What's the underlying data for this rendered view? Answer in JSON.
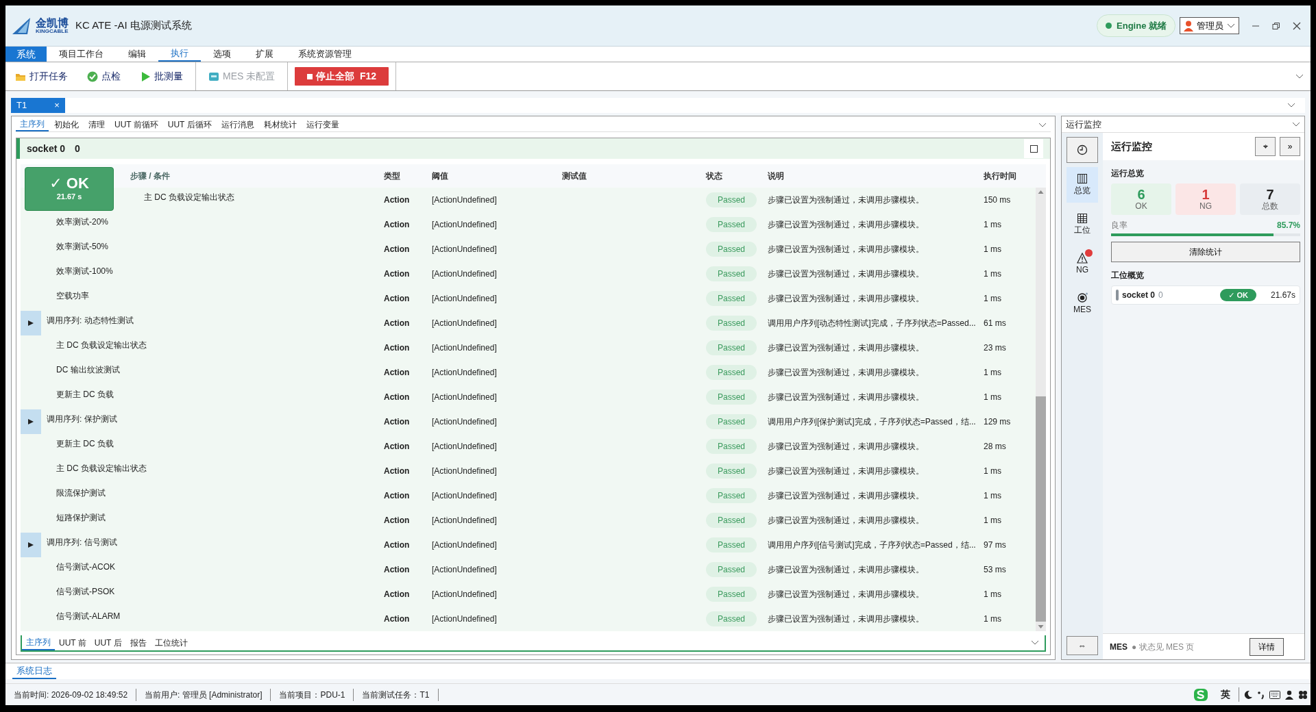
{
  "window": {
    "title": "KC ATE -AI 电源测试系统",
    "brand": "金凯博",
    "brand_sub": "KINGCABLE",
    "engine": {
      "label": "Engine 就绪",
      "color": "#2e9b5c"
    },
    "user": "管理员"
  },
  "menu": [
    {
      "label": "系统",
      "kind": "app",
      "selected": false
    },
    {
      "label": "项目工作台",
      "kind": "item",
      "selected": false
    },
    {
      "label": "编辑",
      "kind": "item",
      "selected": false
    },
    {
      "label": "执行",
      "kind": "item",
      "selected": true
    },
    {
      "label": "选项",
      "kind": "item",
      "selected": false
    },
    {
      "label": "扩展",
      "kind": "item",
      "selected": false
    },
    {
      "label": "系统资源管理",
      "kind": "item",
      "selected": false
    }
  ],
  "toolbar": [
    {
      "label": "打开任务",
      "kind": "folder",
      "disabled": false
    },
    {
      "label": "点检",
      "kind": "check",
      "disabled": false
    },
    {
      "label": "批测量",
      "kind": "play",
      "disabled": false
    },
    {
      "label": "MES 未配置",
      "kind": "mes",
      "disabled": true
    },
    {
      "label": "停止全部  F12",
      "kind": "stop",
      "disabled": false
    }
  ],
  "doc_tabs": [
    {
      "label": "T1",
      "close": "×",
      "selected": true
    }
  ],
  "sub_tabs": [
    {
      "label": "主序列",
      "selected": true
    },
    {
      "label": "初始化",
      "selected": false
    },
    {
      "label": "清理",
      "selected": false
    },
    {
      "label": "UUT 前循环",
      "selected": false
    },
    {
      "label": "UUT 后循环",
      "selected": false
    },
    {
      "label": "运行消息",
      "selected": false
    },
    {
      "label": "耗材统计",
      "selected": false
    },
    {
      "label": "运行变量",
      "selected": false
    }
  ],
  "socket": {
    "title": "socket 0",
    "count": "0",
    "result": {
      "label": "✓ OK",
      "time": "21.67 s"
    }
  },
  "table": {
    "columns": [
      "步骤 / 条件",
      "类型",
      "阈值",
      "测试值",
      "状态",
      "说明",
      "执行时间"
    ],
    "rows": [
      {
        "kind": "step",
        "name": "主 DC 负载设定输出状态",
        "type": "Action",
        "threshold": "[ActionUndefined]",
        "status": "Passed",
        "description": "步骤已设置为强制通过，未调用步骤模块。",
        "time": "150 ms"
      },
      {
        "kind": "step",
        "name": "效率测试-20%",
        "type": "Action",
        "threshold": "[ActionUndefined]",
        "status": "Passed",
        "description": "步骤已设置为强制通过，未调用步骤模块。",
        "time": "1 ms"
      },
      {
        "kind": "step",
        "name": "效率测试-50%",
        "type": "Action",
        "threshold": "[ActionUndefined]",
        "status": "Passed",
        "description": "步骤已设置为强制通过，未调用步骤模块。",
        "time": "1 ms"
      },
      {
        "kind": "step",
        "name": "效率测试-100%",
        "type": "Action",
        "threshold": "[ActionUndefined]",
        "status": "Passed",
        "description": "步骤已设置为强制通过，未调用步骤模块。",
        "time": "1 ms"
      },
      {
        "kind": "step",
        "name": "空载功率",
        "type": "Action",
        "threshold": "[ActionUndefined]",
        "status": "Passed",
        "description": "步骤已设置为强制通过，未调用步骤模块。",
        "time": "1 ms"
      },
      {
        "kind": "call",
        "name": "调用序列: 动态特性测试",
        "type": "Action",
        "threshold": "[ActionUndefined]",
        "status": "Passed",
        "description": "调用用户序列[动态特性测试]完成，子序列状态=Passed...",
        "time": "61 ms"
      },
      {
        "kind": "step",
        "name": "主 DC 负载设定输出状态",
        "type": "Action",
        "threshold": "[ActionUndefined]",
        "status": "Passed",
        "description": "步骤已设置为强制通过，未调用步骤模块。",
        "time": "23 ms"
      },
      {
        "kind": "step",
        "name": "DC 输出纹波测试",
        "type": "Action",
        "threshold": "[ActionUndefined]",
        "status": "Passed",
        "description": "步骤已设置为强制通过，未调用步骤模块。",
        "time": "1 ms"
      },
      {
        "kind": "step",
        "name": "更新主 DC 负载",
        "type": "Action",
        "threshold": "[ActionUndefined]",
        "status": "Passed",
        "description": "步骤已设置为强制通过，未调用步骤模块。",
        "time": "1 ms"
      },
      {
        "kind": "call",
        "name": "调用序列: 保护测试",
        "type": "Action",
        "threshold": "[ActionUndefined]",
        "status": "Passed",
        "description": "调用用户序列[保护测试]完成，子序列状态=Passed，结...",
        "time": "129 ms"
      },
      {
        "kind": "step",
        "name": "更新主 DC 负载",
        "type": "Action",
        "threshold": "[ActionUndefined]",
        "status": "Passed",
        "description": "步骤已设置为强制通过，未调用步骤模块。",
        "time": "28 ms"
      },
      {
        "kind": "step",
        "name": "主 DC 负载设定输出状态",
        "type": "Action",
        "threshold": "[ActionUndefined]",
        "status": "Passed",
        "description": "步骤已设置为强制通过，未调用步骤模块。",
        "time": "1 ms"
      },
      {
        "kind": "step",
        "name": "限流保护测试",
        "type": "Action",
        "threshold": "[ActionUndefined]",
        "status": "Passed",
        "description": "步骤已设置为强制通过，未调用步骤模块。",
        "time": "1 ms"
      },
      {
        "kind": "step",
        "name": "短路保护测试",
        "type": "Action",
        "threshold": "[ActionUndefined]",
        "status": "Passed",
        "description": "步骤已设置为强制通过，未调用步骤模块。",
        "time": "1 ms"
      },
      {
        "kind": "call",
        "name": "调用序列: 信号测试",
        "type": "Action",
        "threshold": "[ActionUndefined]",
        "status": "Passed",
        "description": "调用用户序列[信号测试]完成，子序列状态=Passed，结...",
        "time": "97 ms"
      },
      {
        "kind": "step",
        "name": "信号测试-ACOK",
        "type": "Action",
        "threshold": "[ActionUndefined]",
        "status": "Passed",
        "description": "步骤已设置为强制通过，未调用步骤模块。",
        "time": "53 ms"
      },
      {
        "kind": "step",
        "name": "信号测试-PSOK",
        "type": "Action",
        "threshold": "[ActionUndefined]",
        "status": "Passed",
        "description": "步骤已设置为强制通过，未调用步骤模块。",
        "time": "1 ms"
      },
      {
        "kind": "step",
        "name": "信号测试-ALARM",
        "type": "Action",
        "threshold": "[ActionUndefined]",
        "status": "Passed",
        "description": "步骤已设置为强制通过，未调用步骤模块。",
        "time": "1 ms"
      }
    ]
  },
  "bottom_tabs": [
    {
      "label": "主序列",
      "selected": true
    },
    {
      "label": "UUT 前",
      "selected": false
    },
    {
      "label": "UUT 后",
      "selected": false
    },
    {
      "label": "报告",
      "selected": false
    },
    {
      "label": "工位统计",
      "selected": false
    }
  ],
  "monitor": {
    "panel_title": "运行监控",
    "title": "运行监控",
    "locate_button": "⌖",
    "collapse_button": "»",
    "swap_button": "⇔",
    "nav": [
      {
        "label": "总览",
        "kind": "overview",
        "selected": true,
        "alert": false
      },
      {
        "label": "工位",
        "kind": "stations",
        "selected": false,
        "alert": false
      },
      {
        "label": "NG",
        "kind": "ng",
        "selected": false,
        "alert": true
      },
      {
        "label": "MES",
        "kind": "mes",
        "selected": false,
        "alert": false
      }
    ],
    "summary_title": "运行总览",
    "stats": [
      {
        "value": "6",
        "label": "OK",
        "kind": "ok"
      },
      {
        "value": "1",
        "label": "NG",
        "kind": "ng"
      },
      {
        "value": "7",
        "label": "总数",
        "kind": "total"
      }
    ],
    "yield": {
      "label": "良率",
      "reading": "85.7%",
      "level": 0.857
    },
    "clear_button": "清除统计",
    "stations_title": "工位概览",
    "stations": [
      {
        "name": "socket 0",
        "count": "0",
        "result": "✓ OK",
        "time": "21.67s"
      }
    ],
    "mes": {
      "label": "MES",
      "status": "● 状态见 MES 页",
      "button": "详情"
    }
  },
  "log_tab": {
    "label": "系统日志",
    "selected": true
  },
  "status_bar": [
    "当前时间: 2026-09-02 18:49:52",
    "当前用户: 管理员 [Administrator]",
    "当前项目：PDU-1",
    "当前测试任务：T1"
  ],
  "tray": {
    "language": "英"
  }
}
